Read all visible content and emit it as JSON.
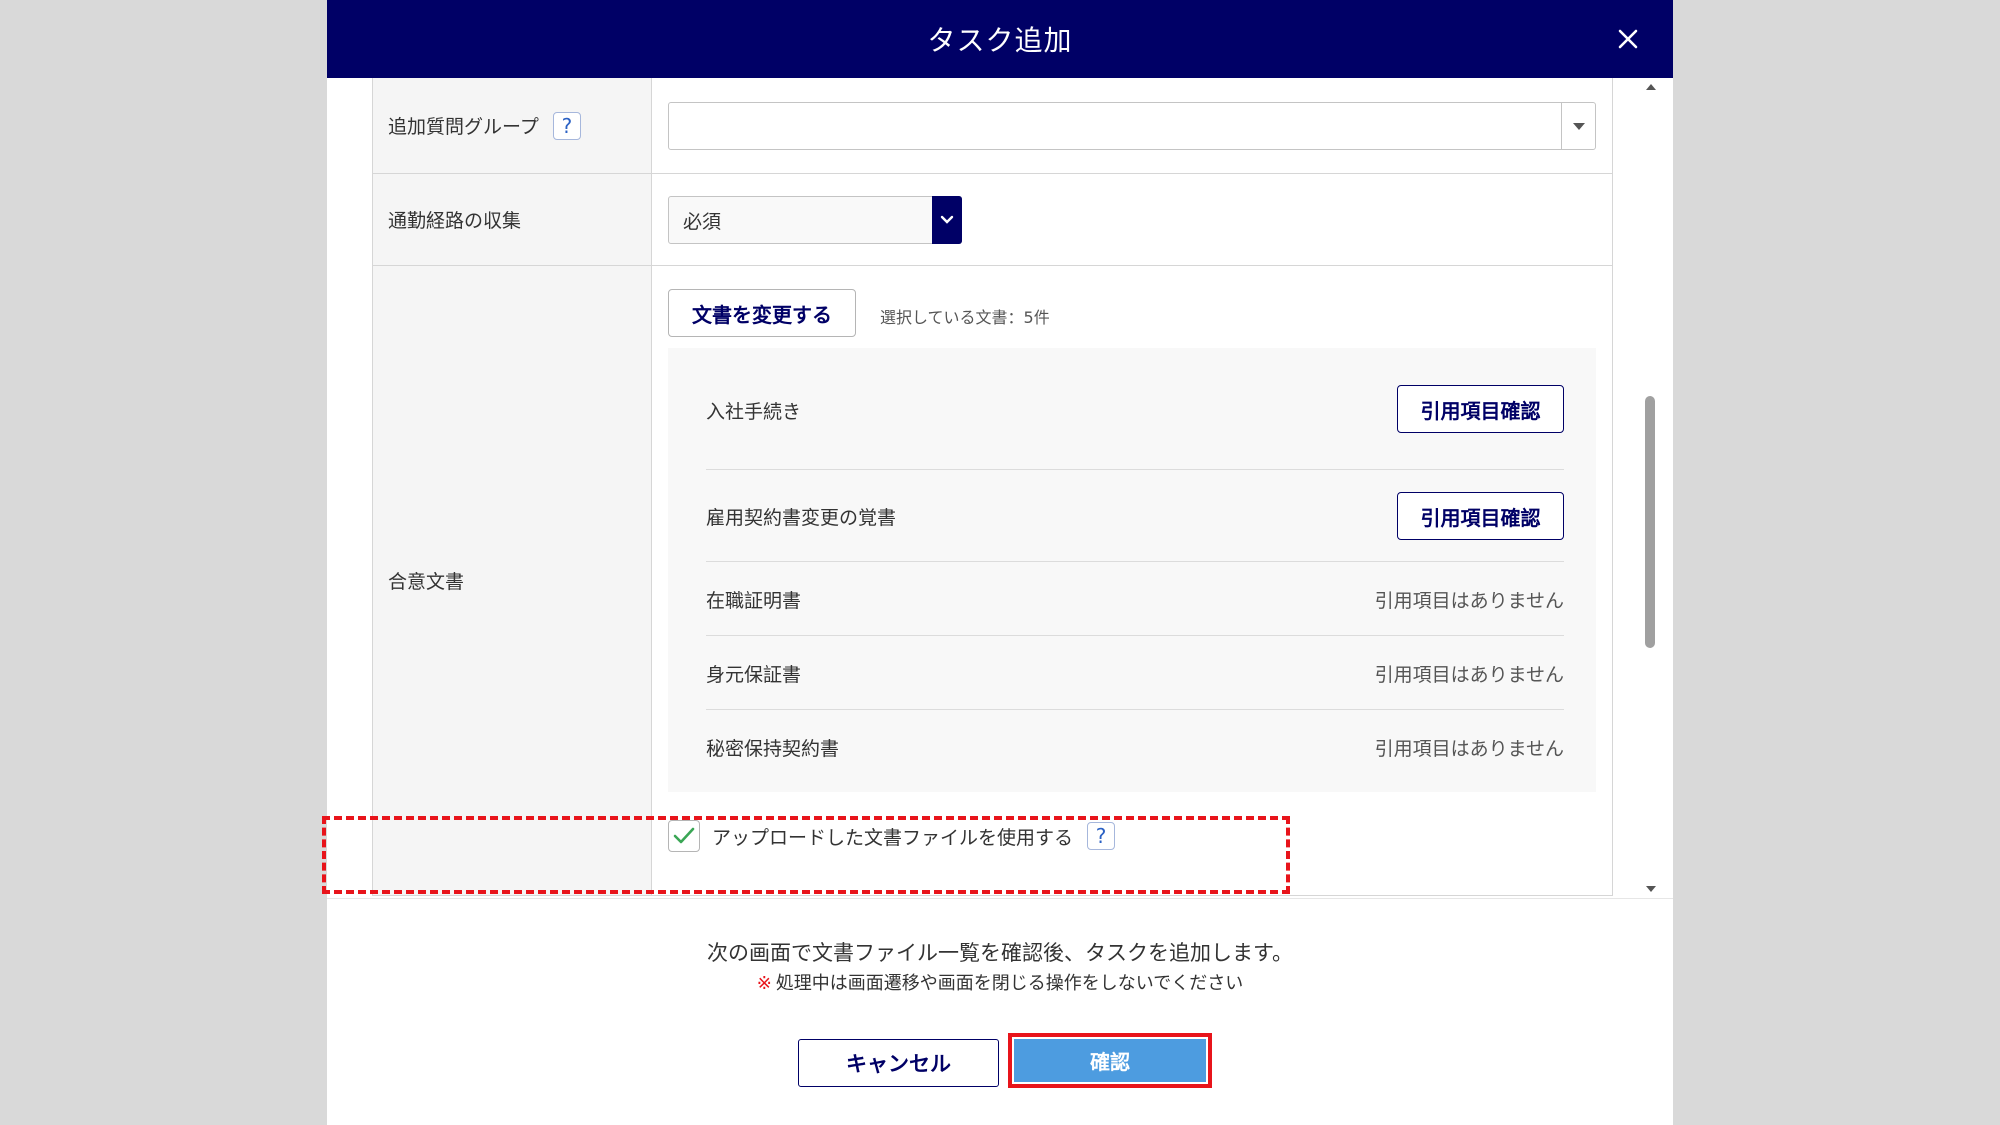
{
  "dialog": {
    "title": "タスク追加",
    "close_label": "×"
  },
  "form": {
    "question_group": {
      "label": "追加質問グループ",
      "help": "?",
      "value": ""
    },
    "commute": {
      "label": "通勤経路の収集",
      "value": "必須"
    },
    "agreement_docs": {
      "label": "合意文書",
      "change_button": "文書を変更する",
      "selected_count": "選択している文書：5件",
      "documents": [
        {
          "name": "入社手続き",
          "action": "引用項目確認"
        },
        {
          "name": "雇用契約書変更の覚書",
          "action": "引用項目確認"
        },
        {
          "name": "在職証明書",
          "note": "引用項目はありません"
        },
        {
          "name": "身元保証書",
          "note": "引用項目はありません"
        },
        {
          "name": "秘密保持契約書",
          "note": "引用項目はありません"
        }
      ],
      "use_uploaded": {
        "label": "アップロードした文書ファイルを使用する",
        "checked": true,
        "help": "?"
      }
    }
  },
  "footer": {
    "message": "次の画面で文書ファイル一覧を確認後、タスクを追加します。",
    "warning_mark": "※",
    "warning": "処理中は画面遷移や画面を閉じる操作をしないでください",
    "cancel_label": "キャンセル",
    "confirm_label": "確認"
  },
  "colors": {
    "header_bg": "#000066",
    "highlight": "#e8141b",
    "confirm_bg": "#4d9ce0",
    "check": "#3aa655"
  }
}
